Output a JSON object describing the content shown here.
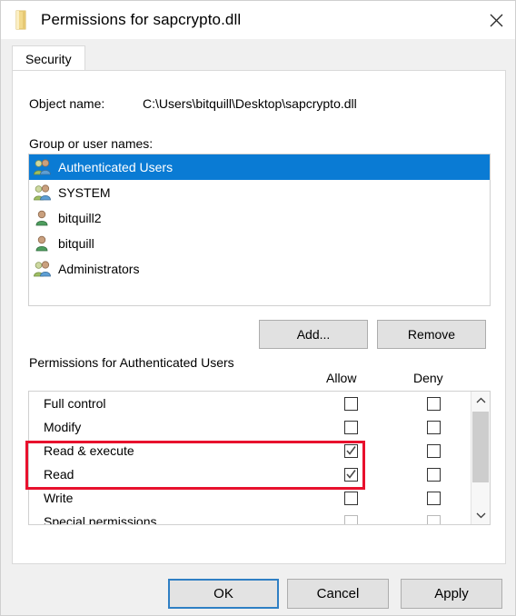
{
  "window": {
    "title": "Permissions for sapcrypto.dll",
    "icon": "scroll-certificate-icon",
    "close_label": "✕"
  },
  "tabs": [
    {
      "label": "Security",
      "active": true
    }
  ],
  "object": {
    "label": "Object name:",
    "value": "C:\\Users\\bitquill\\Desktop\\sapcrypto.dll"
  },
  "group_list": {
    "label": "Group or user names:",
    "items": [
      {
        "name": "Authenticated Users",
        "icon": "group-icon",
        "selected": true
      },
      {
        "name": "SYSTEM",
        "icon": "group-icon",
        "selected": false
      },
      {
        "name": "bitquill2",
        "icon": "user-icon",
        "selected": false
      },
      {
        "name": "bitquill",
        "icon": "user-icon",
        "selected": false
      },
      {
        "name": "Administrators",
        "icon": "group-icon",
        "selected": false
      }
    ]
  },
  "list_buttons": {
    "add": "Add...",
    "remove": "Remove"
  },
  "permissions": {
    "title": "Permissions for Authenticated Users",
    "columns": {
      "allow": "Allow",
      "deny": "Deny"
    },
    "rows": [
      {
        "name": "Full control",
        "allow": false,
        "deny": false,
        "dim": false
      },
      {
        "name": "Modify",
        "allow": false,
        "deny": false,
        "dim": false
      },
      {
        "name": "Read & execute",
        "allow": true,
        "deny": false,
        "dim": false
      },
      {
        "name": "Read",
        "allow": true,
        "deny": false,
        "dim": false
      },
      {
        "name": "Write",
        "allow": false,
        "deny": false,
        "dim": false
      },
      {
        "name": "Special permissions",
        "allow": false,
        "deny": false,
        "dim": true
      }
    ],
    "scrollbar": {
      "up": "⌃",
      "down": "⌄"
    }
  },
  "annotation": {
    "color": "#e8112d",
    "highlights": [
      "Read & execute",
      "Read"
    ]
  },
  "footer": {
    "ok": "OK",
    "cancel": "Cancel",
    "apply": "Apply"
  },
  "colors": {
    "selection": "#0a7bd4",
    "default_button_border": "#2f7fc4",
    "annotation": "#e8112d"
  }
}
